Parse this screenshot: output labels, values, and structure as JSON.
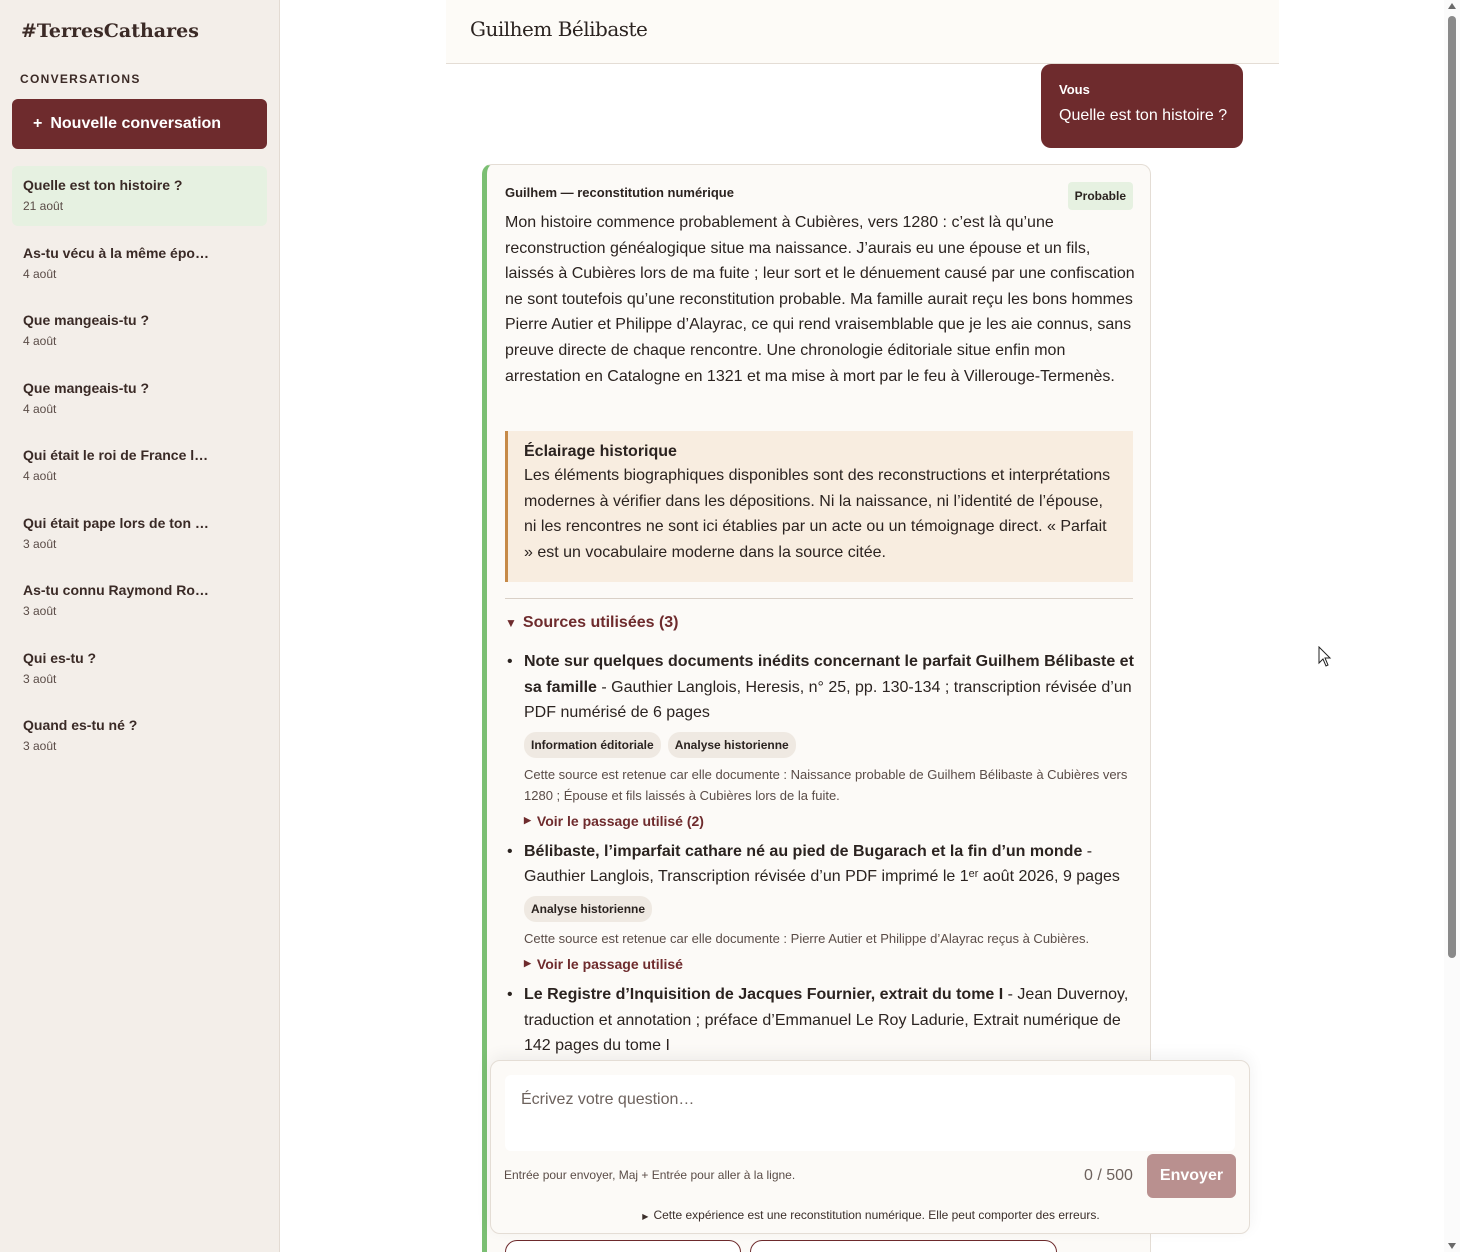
{
  "sidebar": {
    "brand": "#TerresCathares",
    "heading": "CONVERSATIONS",
    "new_conversation": {
      "icon": "+",
      "label": "Nouvelle conversation"
    },
    "items": [
      {
        "title": "Quelle est ton histoire ?",
        "date": "21 août",
        "active": true
      },
      {
        "title": "As-tu vécu à la même épo…",
        "date": "4 août"
      },
      {
        "title": "Que mangeais-tu ?",
        "date": "4 août"
      },
      {
        "title": "Que mangeais-tu ?",
        "date": "4 août"
      },
      {
        "title": "Qui était le roi de France l…",
        "date": "4 août"
      },
      {
        "title": "Qui était pape lors de ton …",
        "date": "3 août"
      },
      {
        "title": "As-tu connu Raymond Ro…",
        "date": "3 août"
      },
      {
        "title": "Qui es-tu ?",
        "date": "3 août"
      },
      {
        "title": "Quand es-tu né ?",
        "date": "3 août"
      }
    ]
  },
  "header": {
    "title": "Guilhem Bélibaste"
  },
  "user_message": {
    "label": "Vous",
    "text": "Quelle est ton histoire ?"
  },
  "assistant": {
    "author": "Guilhem — reconstitution numérique",
    "badge": "Probable",
    "body": "Mon histoire commence probablement à Cubières, vers 1280 : c’est là qu’une reconstruction généalogique situe ma naissance. J’aurais eu une épouse et un fils, laissés à Cubières lors de ma fuite ; leur sort et le dénuement causé par une confiscation ne sont toutefois qu’une reconstitution probable. Ma famille aurait reçu les bons hommes Pierre Autier et Philippe d’Alayrac, ce qui rend vraisemblable que je les aie connus, sans preuve directe de chaque rencontre. Une chronologie éditoriale situe enfin mon arrestation en Catalogne en 1321 et ma mise à mort par le feu à Villerouge-Termenès.",
    "note": {
      "title": "Éclairage historique",
      "text": "Les éléments biographiques disponibles sont des reconstructions et interprétations modernes à vérifier dans les dépositions. Ni la naissance, ni l’identité de l’épouse, ni les rencontres ne sont ici établies par un acte ou un témoignage direct. « Parfait » est un vocabulaire moderne dans la source citée."
    },
    "sources_label": "Sources utilisées (3)",
    "sources": [
      {
        "title": "Note sur quelques documents inédits concernant le parfait Guilhem Bélibaste et sa famille",
        "details": " - Gauthier Langlois, Heresis, n° 25, pp. 130-134 ; transcription révisée d’un PDF numérisé de 6 pages",
        "tags": [
          "Information éditoriale",
          "Analyse historienne"
        ],
        "reason": "Cette source est retenue car elle documente : Naissance probable de Guilhem Bélibaste à Cubières vers 1280 ; Épouse et fils laissés à Cubières lors de la fuite.",
        "passage": "Voir le passage utilisé (2)"
      },
      {
        "title": "Bélibaste, l’imparfait cathare né au pied de Bugarach et la fin d’un monde",
        "details": " - Gauthier Langlois, Transcription révisée d’un PDF imprimé le 1ᵉʳ août 2026, 9 pages",
        "tags": [
          "Analyse historienne"
        ],
        "reason": "Cette source est retenue car elle documente : Pierre Autier et Philippe d’Alayrac reçus à Cubières.",
        "passage": "Voir le passage utilisé"
      },
      {
        "title": "Le Registre d’Inquisition de Jacques Fournier, extrait du tome I",
        "details": " - Jean Duvernoy, traduction et annotation ; préface d’Emmanuel Le Roy Ladurie, Extrait numérique de 142 pages du tome I"
      }
    ]
  },
  "composer": {
    "placeholder": "Écrivez votre question…",
    "hint": "Entrée pour envoyer, Maj + Entrée pour aller à la ligne.",
    "counter": "0 / 500",
    "send_label": "Envoyer",
    "disclaimer": "Cette expérience est une reconstitution numérique. Elle peut comporter des erreurs."
  },
  "colors": {
    "accent": "#6e2b2d",
    "active_item": "#e6f1e1",
    "card_border": "#7bbf73",
    "note_bg": "#f8ede0",
    "note_border": "#c68a48",
    "send_disabled": "#b9908f"
  }
}
